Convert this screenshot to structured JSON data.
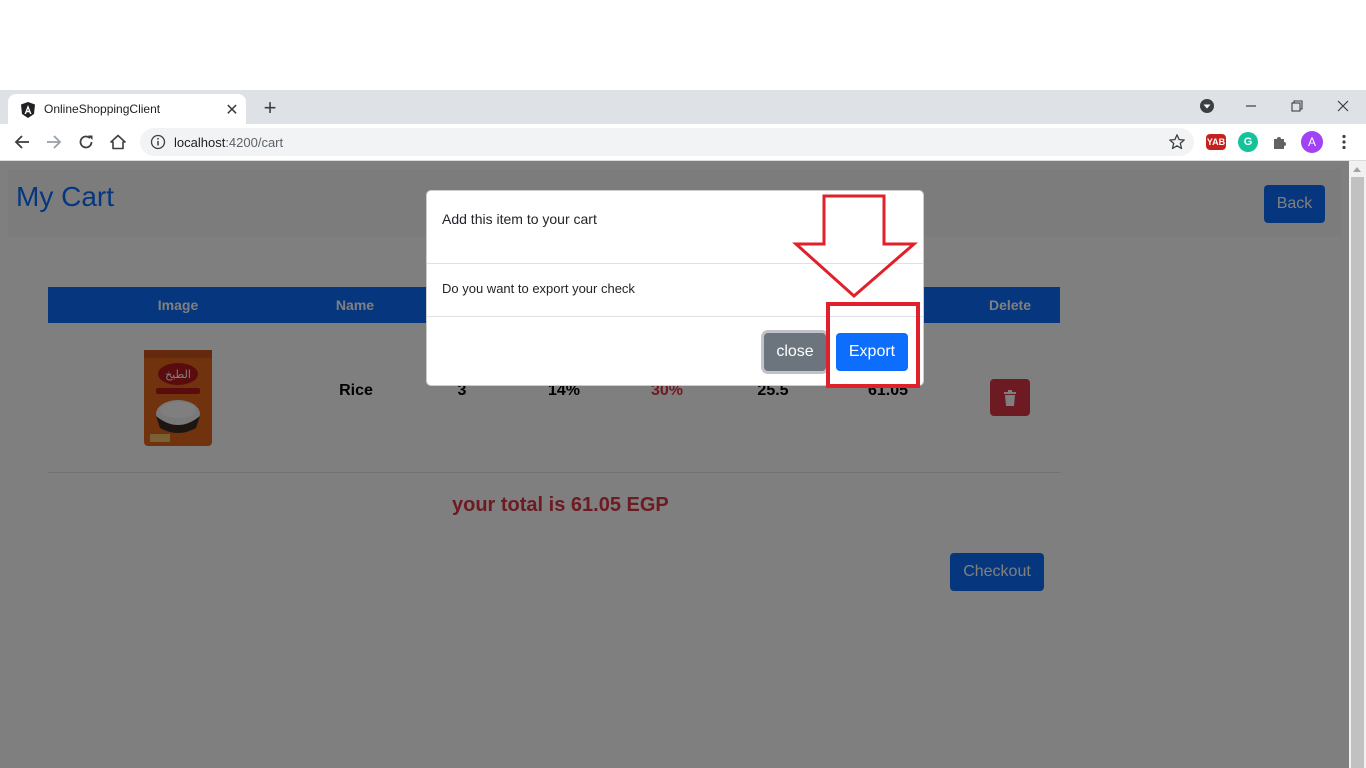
{
  "browser": {
    "tab_title": "OnlineShoppingClient",
    "url_host": "localhost",
    "url_path": ":4200/cart",
    "extension_yab": "YAB",
    "profile_initial": "A"
  },
  "page": {
    "title": "My Cart",
    "back_label": "Back",
    "table": {
      "headers": [
        "Image",
        "Name",
        "",
        "",
        "",
        "",
        "",
        "Delete"
      ],
      "row": {
        "name": "Rice",
        "quantity": "3",
        "tax": "14%",
        "discount": "30%",
        "price": "25.5",
        "total": "61.05"
      }
    },
    "total_text": "your total is 61.05 EGP",
    "checkout_label": "Checkout"
  },
  "modal": {
    "title": "Add this item to your cart",
    "body": "Do you want to export your check",
    "close_label": "close",
    "export_label": "Export"
  },
  "colors": {
    "primary": "#0d6efd",
    "danger": "#dc3545",
    "secondary": "#6c757d",
    "annotation": "#e0202a"
  }
}
